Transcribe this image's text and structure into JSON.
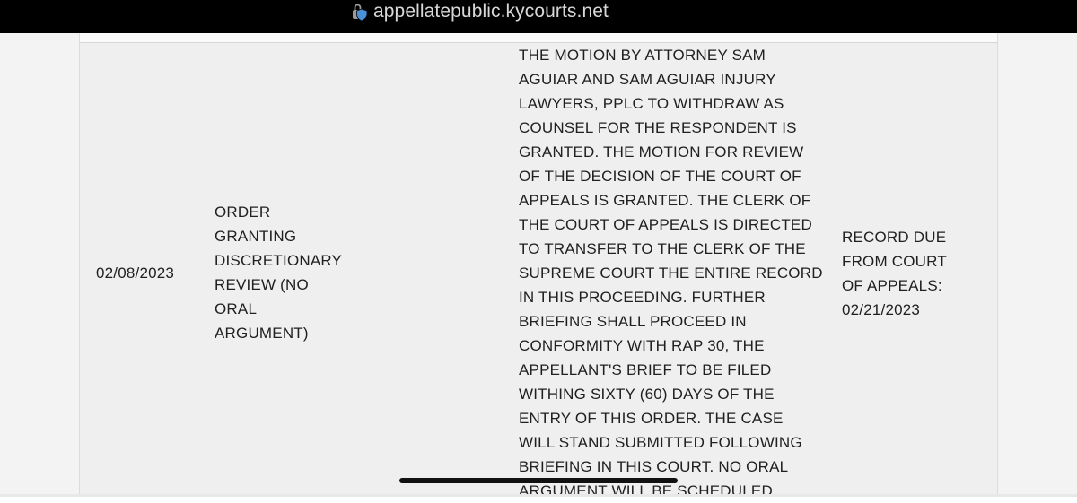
{
  "browser": {
    "url": "appellatepublic.kycourts.net",
    "lock_icon": "lock-shield-icon"
  },
  "docket_row": {
    "date": "02/08/2023",
    "entry_type": "ORDER GRANTING DISCRETIONARY REVIEW (NO ORAL ARGUMENT)",
    "description": "THE MOTION BY ATTORNEY SAM AGUIAR AND SAM AGUIAR INJURY LAWYERS, PPLC TO WITHDRAW AS COUNSEL FOR THE RESPONDENT IS GRANTED. THE MOTION FOR REVIEW OF THE DECISION OF THE COURT OF APPEALS IS GRANTED. THE CLERK OF THE COURT OF APPEALS IS DIRECTED TO TRANSFER TO THE CLERK OF THE SUPREME COURT THE ENTIRE RECORD IN THIS PROCEEDING. FURTHER BRIEFING SHALL PROCEED IN CONFORMITY WITH RAP 30, THE APPELLANT'S BRIEF TO BE FILED WITHING SIXTY (60) DAYS OF THE ENTRY OF THIS ORDER. THE CASE WILL STAND SUBMITTED FOLLOWING BRIEFING IN THIS COURT. NO ORAL ARGUMENT WILL BE SCHEDULED",
    "note": "RECORD DUE FROM COURT OF APPEALS: 02/21/2023"
  }
}
